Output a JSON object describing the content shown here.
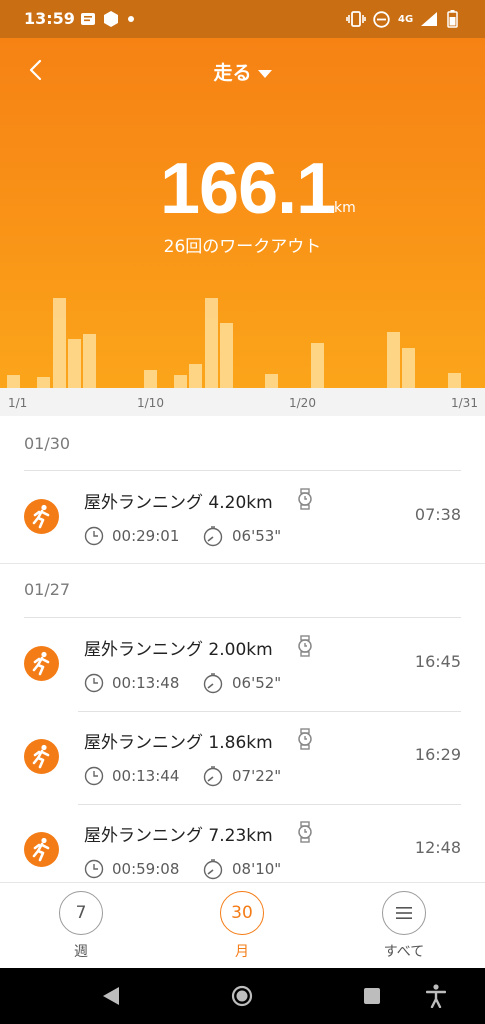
{
  "status_bar": {
    "time": "13:59",
    "network": "4G"
  },
  "header": {
    "title": "走る"
  },
  "summary": {
    "distance": "166.1",
    "unit": "km",
    "workouts": "26回のワークアウト"
  },
  "chart": {
    "bar_values": [
      0.12,
      0,
      0.1,
      0.83,
      0.45,
      0.5,
      0,
      0,
      0,
      0.17,
      0,
      0.12,
      0.22,
      0.83,
      0.6,
      0,
      0,
      0.13,
      0,
      0,
      0.42,
      0,
      0,
      0,
      0,
      0.52,
      0.37,
      0,
      0,
      0.14
    ],
    "ticks": [
      "1/1",
      "1/10",
      "1/20",
      "1/31"
    ],
    "colors": {
      "bar": "#ffe6aa",
      "accent": "#f47c16"
    }
  },
  "groups": [
    {
      "date": "01/30",
      "items": [
        {
          "title": "屋外ランニング",
          "distance": "4.20km",
          "duration": "00:29:01",
          "pace": "06'53\"",
          "time": "07:38"
        }
      ]
    },
    {
      "date": "01/27",
      "items": [
        {
          "title": "屋外ランニング",
          "distance": "2.00km",
          "duration": "00:13:48",
          "pace": "06'52\"",
          "time": "16:45"
        },
        {
          "title": "屋外ランニング",
          "distance": "1.86km",
          "duration": "00:13:44",
          "pace": "07'22\"",
          "time": "16:29"
        },
        {
          "title": "屋外ランニング",
          "distance": "7.23km",
          "duration": "00:59:08",
          "pace": "08'10\"",
          "time": "12:48"
        }
      ]
    }
  ],
  "tabs": [
    {
      "icon_text": "7",
      "label": "週",
      "active": false
    },
    {
      "icon_text": "30",
      "label": "月",
      "active": true
    },
    {
      "icon_text": "",
      "label": "すべて",
      "active": false
    }
  ]
}
